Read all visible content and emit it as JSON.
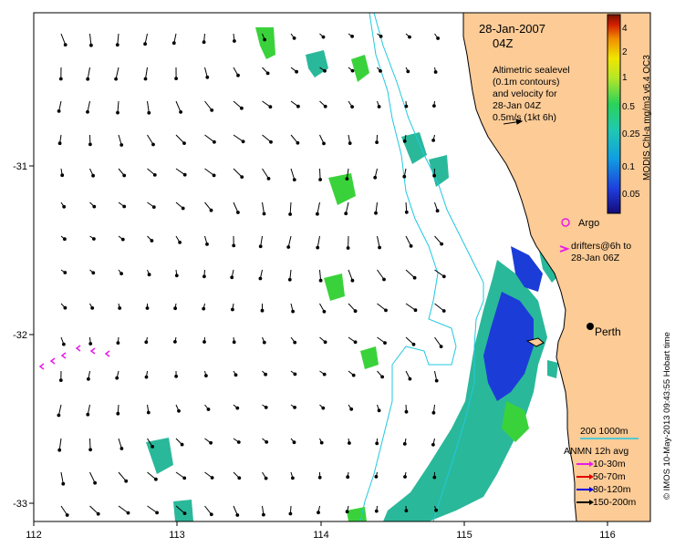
{
  "map": {
    "date": "28-Jan-2007",
    "time": "04Z",
    "altimetry_note": [
      "Altimetric sealevel",
      "(0.1m contours)",
      "and velocity for",
      "28-Jan 04Z",
      "0.5m/s (1kt 6h)"
    ],
    "argo_label": "Argo",
    "drifters_label": [
      "drifters@6h to",
      "28-Jan 06Z"
    ],
    "city_label": "Perth",
    "isobath_label": "200  1000m",
    "anmn_title": "ANMN 12h avg",
    "anmn_legend": [
      {
        "label": "10-30m",
        "color": "#e81ce8"
      },
      {
        "label": "50-70m",
        "color": "#e00000"
      },
      {
        "label": "80-120m",
        "color": "#0000e0"
      },
      {
        "label": "150-200m",
        "color": "#000000"
      }
    ],
    "credit": "© IMOS 10-May-2013 09:43:55 Hobart time",
    "colorbar_title": "MODIS Chl-a mg/m3 v6.4 OC3",
    "colorbar_ticks": [
      "4",
      "2",
      "1",
      "0.5",
      "0.25",
      "0.1",
      "0.05"
    ],
    "x_ticks": [
      "112",
      "113",
      "114",
      "115",
      "116"
    ],
    "y_ticks": [
      "-31",
      "-32",
      "-33"
    ],
    "colors": {
      "land": "#fccb96",
      "isobath": "#20c8e0",
      "drifter": "#e81ce8",
      "argo": "#e81ce8",
      "chl_high": "#1c3cd8",
      "chl_mid": "#2ab89a",
      "chl_low": "#3ad23a"
    }
  }
}
